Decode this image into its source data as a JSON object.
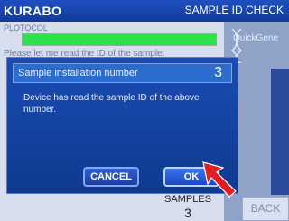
{
  "app": {
    "logo": "KURABO",
    "screen_title": "SAMPLE ID CHECK"
  },
  "main": {
    "protocol_label": "PLOTOCOL",
    "message": "Please let me read the ID of the sample."
  },
  "sidebar": {
    "brand": "QuickGene",
    "back_label": "BACK"
  },
  "samples": {
    "label": "SAMPLES",
    "value": "3"
  },
  "dialog": {
    "title": "Sample installation number",
    "number": "3",
    "text": "Device has read the sample ID of the above number.",
    "cancel_label": "CANCEL",
    "ok_label": "OK"
  },
  "colors": {
    "accent_blue": "#1a4cb4",
    "progress_green": "#2ee04a",
    "arrow_red": "#e02020"
  },
  "icons": {
    "logo_mark": "kurabo-logo-mark",
    "dna": "dna-icon",
    "pointer": "arrow-pointer-icon"
  }
}
